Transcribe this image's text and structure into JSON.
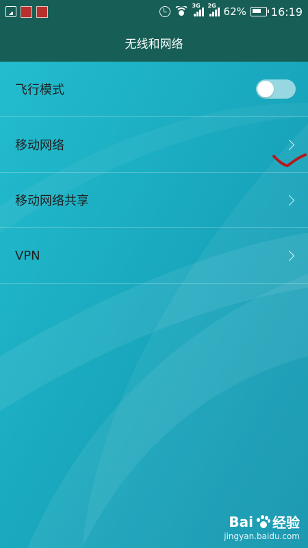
{
  "status_bar": {
    "network_type_1": "3G",
    "network_type_2": "2G",
    "battery": "62%",
    "time": "16:19",
    "notification_icons": [
      "image-icon",
      "app-badge-icon",
      "app-badge-icon"
    ]
  },
  "header": {
    "title": "无线和网络"
  },
  "settings": {
    "items": [
      {
        "label": "飞行模式",
        "control": "toggle",
        "state": "off"
      },
      {
        "label": "移动网络",
        "control": "chevron"
      },
      {
        "label": "移动网络共享",
        "control": "chevron"
      },
      {
        "label": "VPN",
        "control": "chevron"
      }
    ]
  },
  "watermark": {
    "brand": "Bai",
    "brand_suffix": "经验",
    "url": "jingyan.baidu.com"
  },
  "colors": {
    "header_bg": "#165e56",
    "background": "#1aa9bd",
    "annotation": "#b3191d"
  }
}
